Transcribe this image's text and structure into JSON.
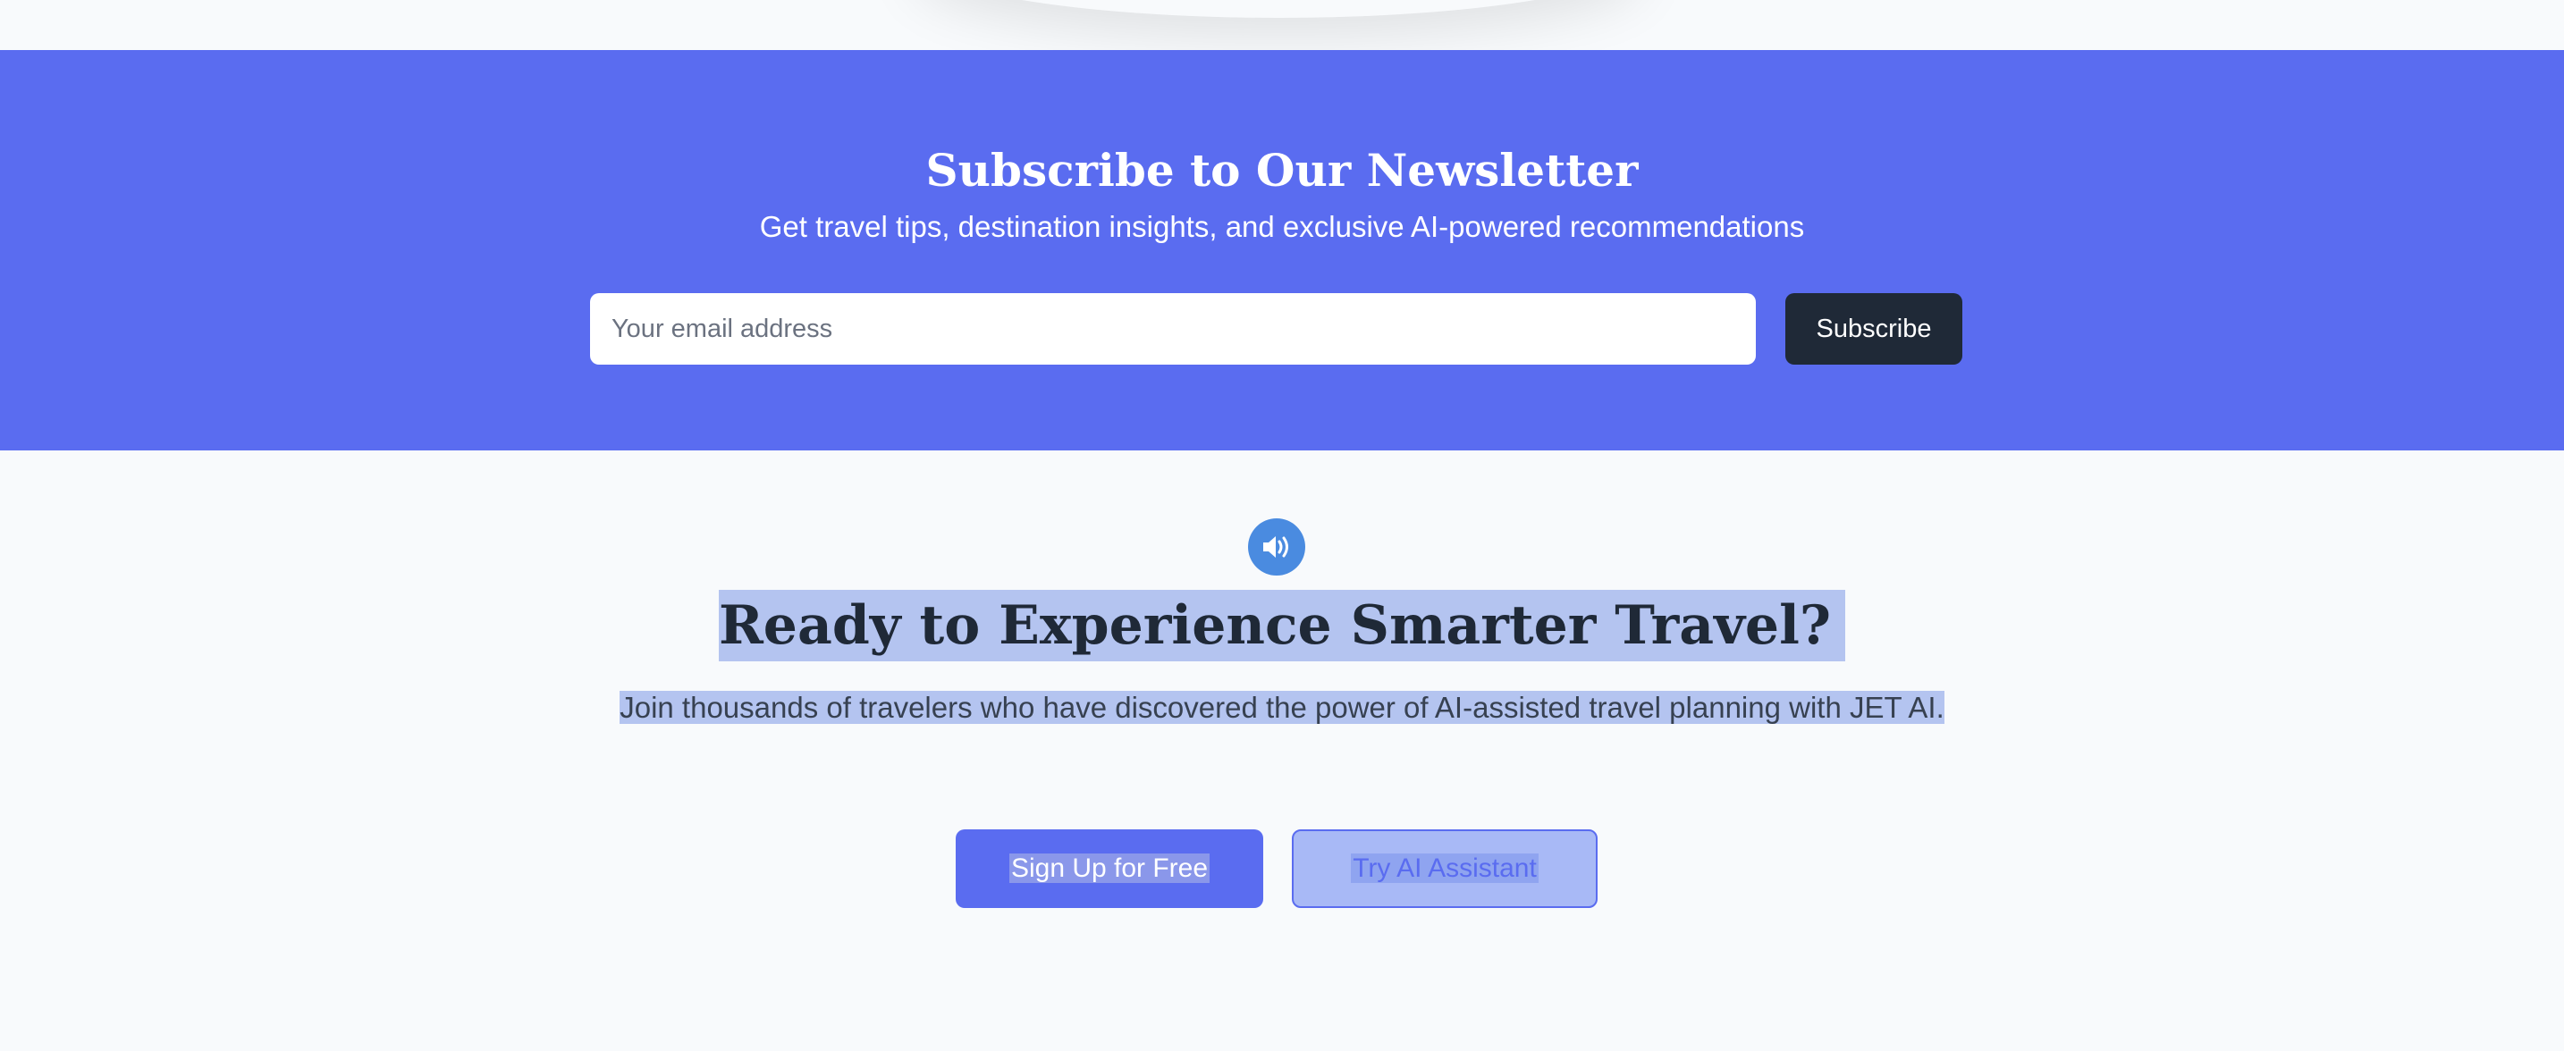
{
  "newsletter": {
    "title": "Subscribe to Our Newsletter",
    "subtitle": "Get travel tips, destination insights, and exclusive AI-powered recommendations",
    "email_placeholder": "Your email address",
    "subscribe_label": "Subscribe"
  },
  "cta": {
    "icon": "speaker-volume-icon",
    "title": "Ready to Experience Smarter Travel?",
    "description": "Join thousands of travelers who have discovered the power of AI-assisted travel planning with JET AI.",
    "primary_label": "Sign Up for Free",
    "secondary_label": "Try AI Assistant"
  },
  "colors": {
    "brand": "#5a6cf0",
    "dark": "#1f2937",
    "icon_bg": "#4a8be0",
    "page_bg": "#f8fafc",
    "selection": "#b4c4f0"
  }
}
